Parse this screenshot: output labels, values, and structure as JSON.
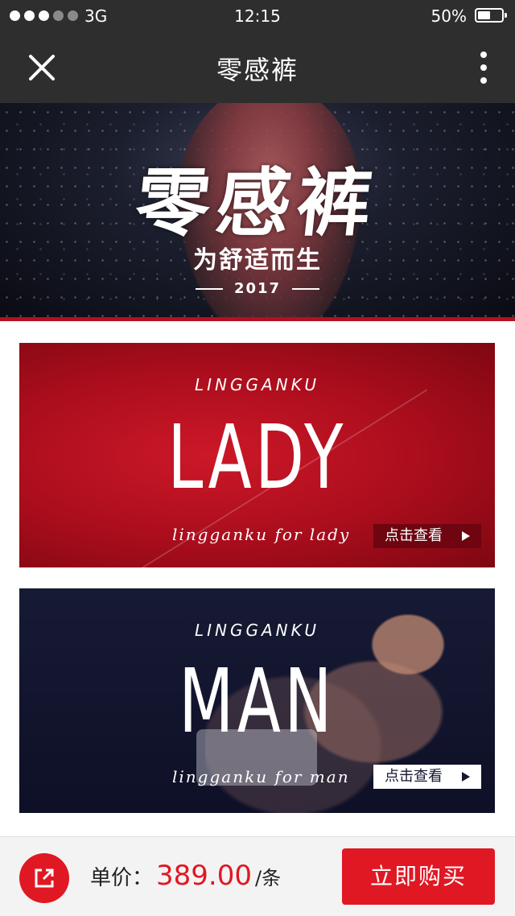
{
  "status_bar": {
    "carrier": "3G",
    "time": "12:15",
    "battery_percent": "50%",
    "battery_level": 0.5
  },
  "nav": {
    "title": "零感裤",
    "close_icon": "close-icon",
    "more_icon": "more-vertical-icon"
  },
  "hero": {
    "title": "零感裤",
    "subtitle": "为舒适而生",
    "year": "2017"
  },
  "cards": [
    {
      "brand": "LINGGANKU",
      "headline": "LADY",
      "tagline": "lingganku  for  lady",
      "button_label": "点击查看",
      "button_icon": "play-triangle-icon",
      "color": "#b80f1e"
    },
    {
      "brand": "LINGGANKU",
      "headline": "MAN",
      "tagline": "lingganku  for  man",
      "button_label": "点击查看",
      "button_icon": "play-triangle-icon",
      "color": "#14172f"
    }
  ],
  "bottom_bar": {
    "share_icon": "share-icon",
    "price_label": "单价：",
    "price_value": "389.00",
    "price_unit": "/条",
    "buy_label": "立即购买",
    "accent_color": "#e01823"
  }
}
